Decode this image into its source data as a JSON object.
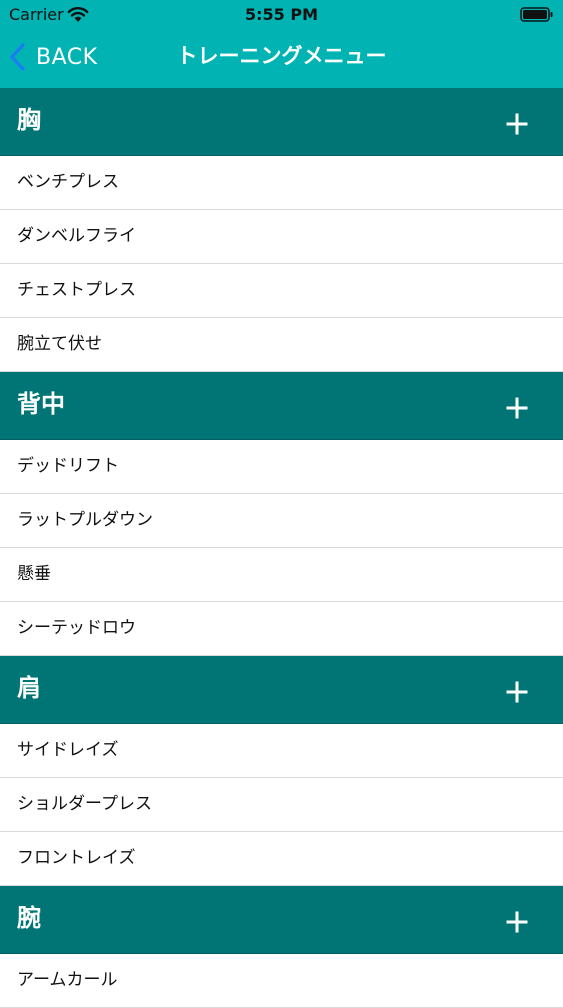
{
  "status_bar": {
    "carrier": "Carrier",
    "time": "5:55 PM",
    "wifi_icon": "wifi-icon",
    "battery_icon": "battery-icon"
  },
  "nav": {
    "back_label": "BACK",
    "title": "トレーニングメニュー"
  },
  "colors": {
    "nav_background": "#01b3b3",
    "section_background": "#017575",
    "back_chevron": "#1a7ff0",
    "row_divider": "#d9d9d9"
  },
  "sections": [
    {
      "title": "胸",
      "items": [
        "ベンチプレス",
        "ダンベルフライ",
        "チェストプレス",
        "腕立て伏せ"
      ]
    },
    {
      "title": "背中",
      "items": [
        "デッドリフト",
        "ラットプルダウン",
        "懸垂",
        "シーテッドロウ"
      ]
    },
    {
      "title": "肩",
      "items": [
        "サイドレイズ",
        "ショルダープレス",
        "フロントレイズ"
      ]
    },
    {
      "title": "腕",
      "items": [
        "アームカール"
      ]
    }
  ]
}
